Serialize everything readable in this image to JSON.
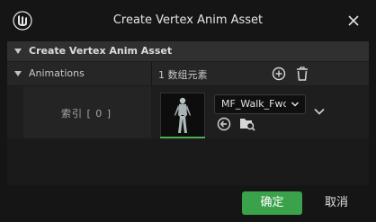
{
  "window": {
    "title": "Create Vertex Anim Asset"
  },
  "section": {
    "title": "Create Vertex Anim Asset"
  },
  "animations": {
    "label": "Animations",
    "count_text": "1 数组元素",
    "items": [
      {
        "index_label": "索引 [ 0 ]",
        "asset_name": "MF_Walk_Fwd"
      }
    ]
  },
  "footer": {
    "ok_label": "确定",
    "cancel_label": "取消"
  },
  "colors": {
    "accent": "#3aa24a",
    "background": "#151515",
    "panel": "#1e1e1e"
  },
  "icons": [
    "unreal-logo-icon",
    "close-icon",
    "add-icon",
    "trash-icon",
    "chevron-down-icon",
    "use-selected-icon",
    "browse-icon"
  ]
}
